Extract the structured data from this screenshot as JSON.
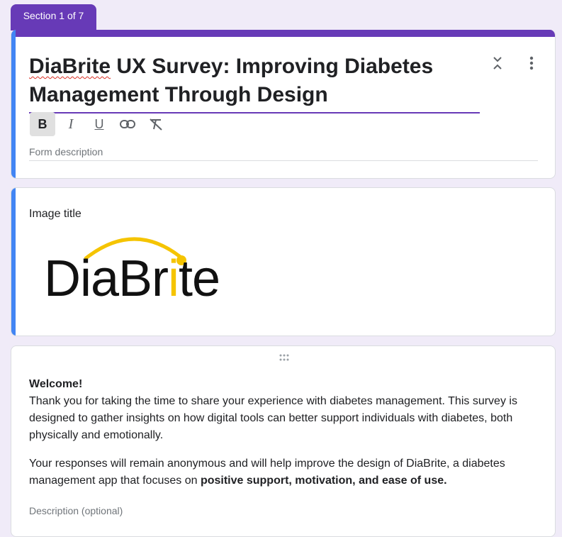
{
  "section_tab": "Section 1 of 7",
  "form": {
    "title_part1": "DiaBrite",
    "title_part2": " UX Survey: Improving Diabetes Management Through Design",
    "description_placeholder": "Form description"
  },
  "toolbar": {
    "bold": "B",
    "italic": "I",
    "underline": "U"
  },
  "image_item": {
    "title": "Image title",
    "logo_text_before": "DiaBr",
    "logo_text_i": "i",
    "logo_text_after": "te"
  },
  "welcome": {
    "heading": "Welcome!",
    "paragraph1": "Thank you for taking the time to share your experience with diabetes management. This survey is designed to gather insights on how digital tools can better support individuals with diabetes, both physically and emotionally.",
    "paragraph2_start": "Your responses will remain anonymous and will help improve the design of DiaBrite, a diabetes management app that focuses on ",
    "paragraph2_bold": "positive support, motivation, and ease of use.",
    "description_placeholder": "Description (optional)"
  },
  "colors": {
    "accent_purple": "#673ab7",
    "accent_blue": "#4285f4",
    "logo_yellow": "#f5c400",
    "background": "#f0ebf8"
  },
  "icons": [
    "collapse-icon",
    "more-vert-icon",
    "link-icon",
    "clear-format-icon",
    "drag-handle-icon"
  ]
}
